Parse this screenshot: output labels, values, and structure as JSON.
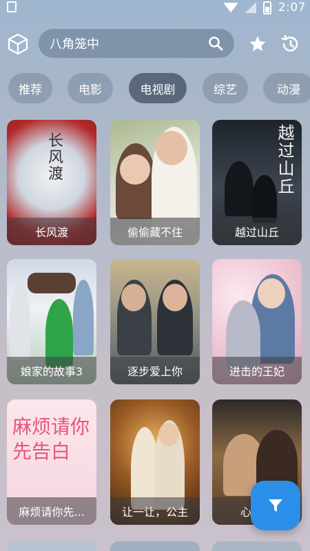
{
  "status_bar": {
    "time": "2:07"
  },
  "search": {
    "placeholder": "八角笼中"
  },
  "tabs": [
    {
      "label": "推荐",
      "active": false
    },
    {
      "label": "电影",
      "active": false
    },
    {
      "label": "电视剧",
      "active": true
    },
    {
      "label": "综艺",
      "active": false
    },
    {
      "label": "动漫",
      "active": false
    }
  ],
  "cards": [
    {
      "title": "长风渡",
      "poster_text": "长风渡",
      "theme": "#d8dde6"
    },
    {
      "title": "偷偷藏不住",
      "poster_text": "",
      "theme": "#c9d3bd"
    },
    {
      "title": "越过山丘",
      "poster_text": "越过山丘",
      "theme": "#3b4048"
    },
    {
      "title": "娘家的故事3",
      "poster_text": "",
      "theme": "#d5dde6"
    },
    {
      "title": "逐步爱上你",
      "poster_text": "",
      "theme": "#9a9486"
    },
    {
      "title": "进击的王妃",
      "poster_text": "",
      "theme": "#f1d9e2"
    },
    {
      "title": "麻烦请你先...",
      "poster_text": "麻烦请你先告白",
      "theme": "#f6dde4"
    },
    {
      "title": "让一让，公主",
      "poster_text": "",
      "theme": "#6b4a2b"
    },
    {
      "title": "心底里",
      "poster_text": "",
      "theme": "#7b5a3a"
    }
  ],
  "colors": {
    "fab": "#2b8ee8",
    "tab_active": "#3c4a5c",
    "tab_inactive": "#76869a"
  }
}
